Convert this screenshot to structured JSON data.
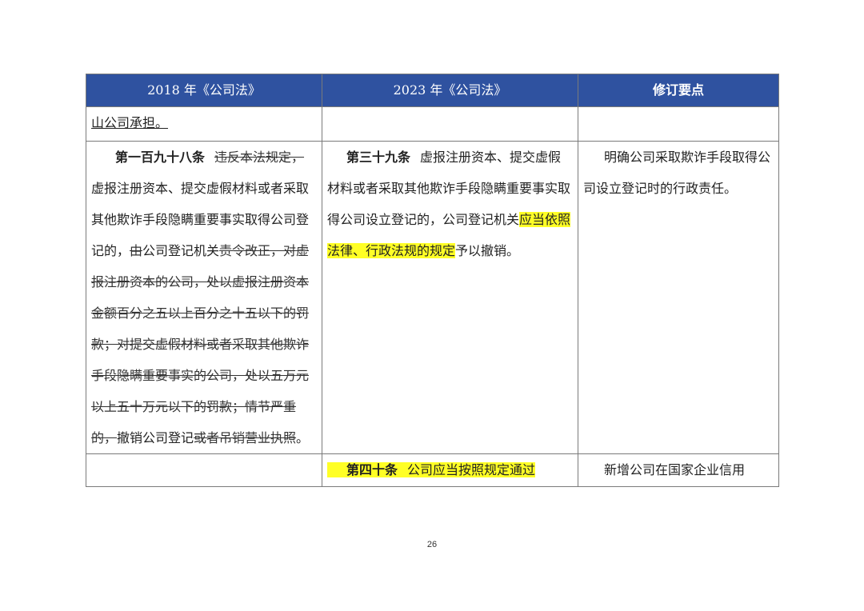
{
  "table": {
    "headers": [
      "2018 年《公司法》",
      "2023 年《公司法》",
      "修订要点"
    ],
    "row1": {
      "col1": "山公司承担。",
      "col2": "",
      "col3": ""
    },
    "row2": {
      "col1_title": "第一百九十八条",
      "col1_del1": "违反本法规定，",
      "col1_t1": "虚报注册资本、提交虚假材料或者采取其他欺诈手段隐瞒重要事实取得公司登记的，",
      "col1_del2": "由",
      "col1_t2": "公司登记机关",
      "col1_del3": "责令改正，对虚报注册资本的公司，处以虚报注册资本金额百分之五以上百分之十五以下的罚款；对提交虚假材料或者采取其他欺诈手段隐瞒重要事实的公司，处以五万元以上五十万元以下的罚款；情节严重的，",
      "col1_t3": "撤销公司登记",
      "col1_del4": "或者吊销营业执照",
      "col1_t4": "。",
      "col2_title": "第三十九条",
      "col2_t1": "虚报注册资本、提交虚假材料或者采取其他欺诈手段隐瞒重要事实取得公司设立登记的，公司登记机关",
      "col2_hl": "应当依照法律、行政法规的规定",
      "col2_t2": "予以撤销。",
      "col3": "明确公司采取欺诈手段取得公司设立登记时的行政责任。"
    },
    "row3": {
      "col1": "",
      "col2_title": "第四十条",
      "col2_t1": "公司应当按照规定通过",
      "col3": "新增公司在国家企业信用"
    }
  },
  "page_number": "26"
}
